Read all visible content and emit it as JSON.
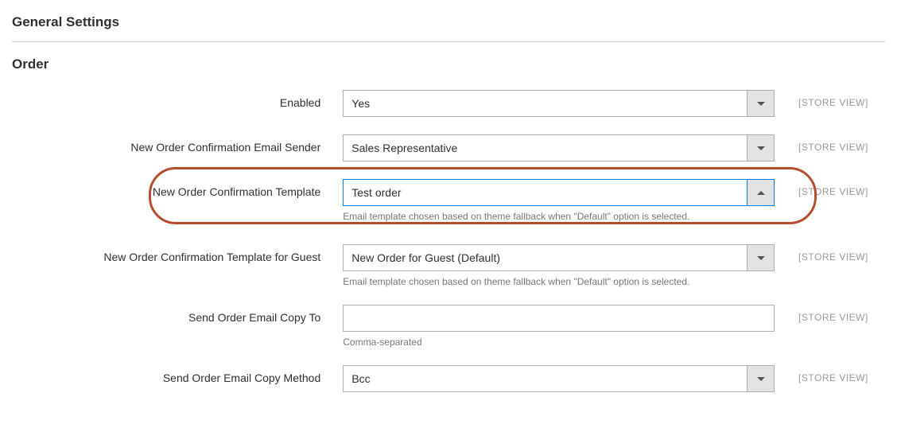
{
  "general_settings_title": "General Settings",
  "order_section_title": "Order",
  "scope_label": "[STORE VIEW]",
  "fields": {
    "enabled": {
      "label": "Enabled",
      "value": "Yes"
    },
    "sender": {
      "label": "New Order Confirmation Email Sender",
      "value": "Sales Representative"
    },
    "template": {
      "label": "New Order Confirmation Template",
      "value": "Test order",
      "hint": "Email template chosen based on theme fallback when \"Default\" option is selected."
    },
    "guest_template": {
      "label": "New Order Confirmation Template for Guest",
      "value": "New Order for Guest (Default)",
      "hint": "Email template chosen based on theme fallback when \"Default\" option is selected."
    },
    "copy_to": {
      "label": "Send Order Email Copy To",
      "value": "",
      "hint": "Comma-separated"
    },
    "copy_method": {
      "label": "Send Order Email Copy Method",
      "value": "Bcc"
    }
  }
}
